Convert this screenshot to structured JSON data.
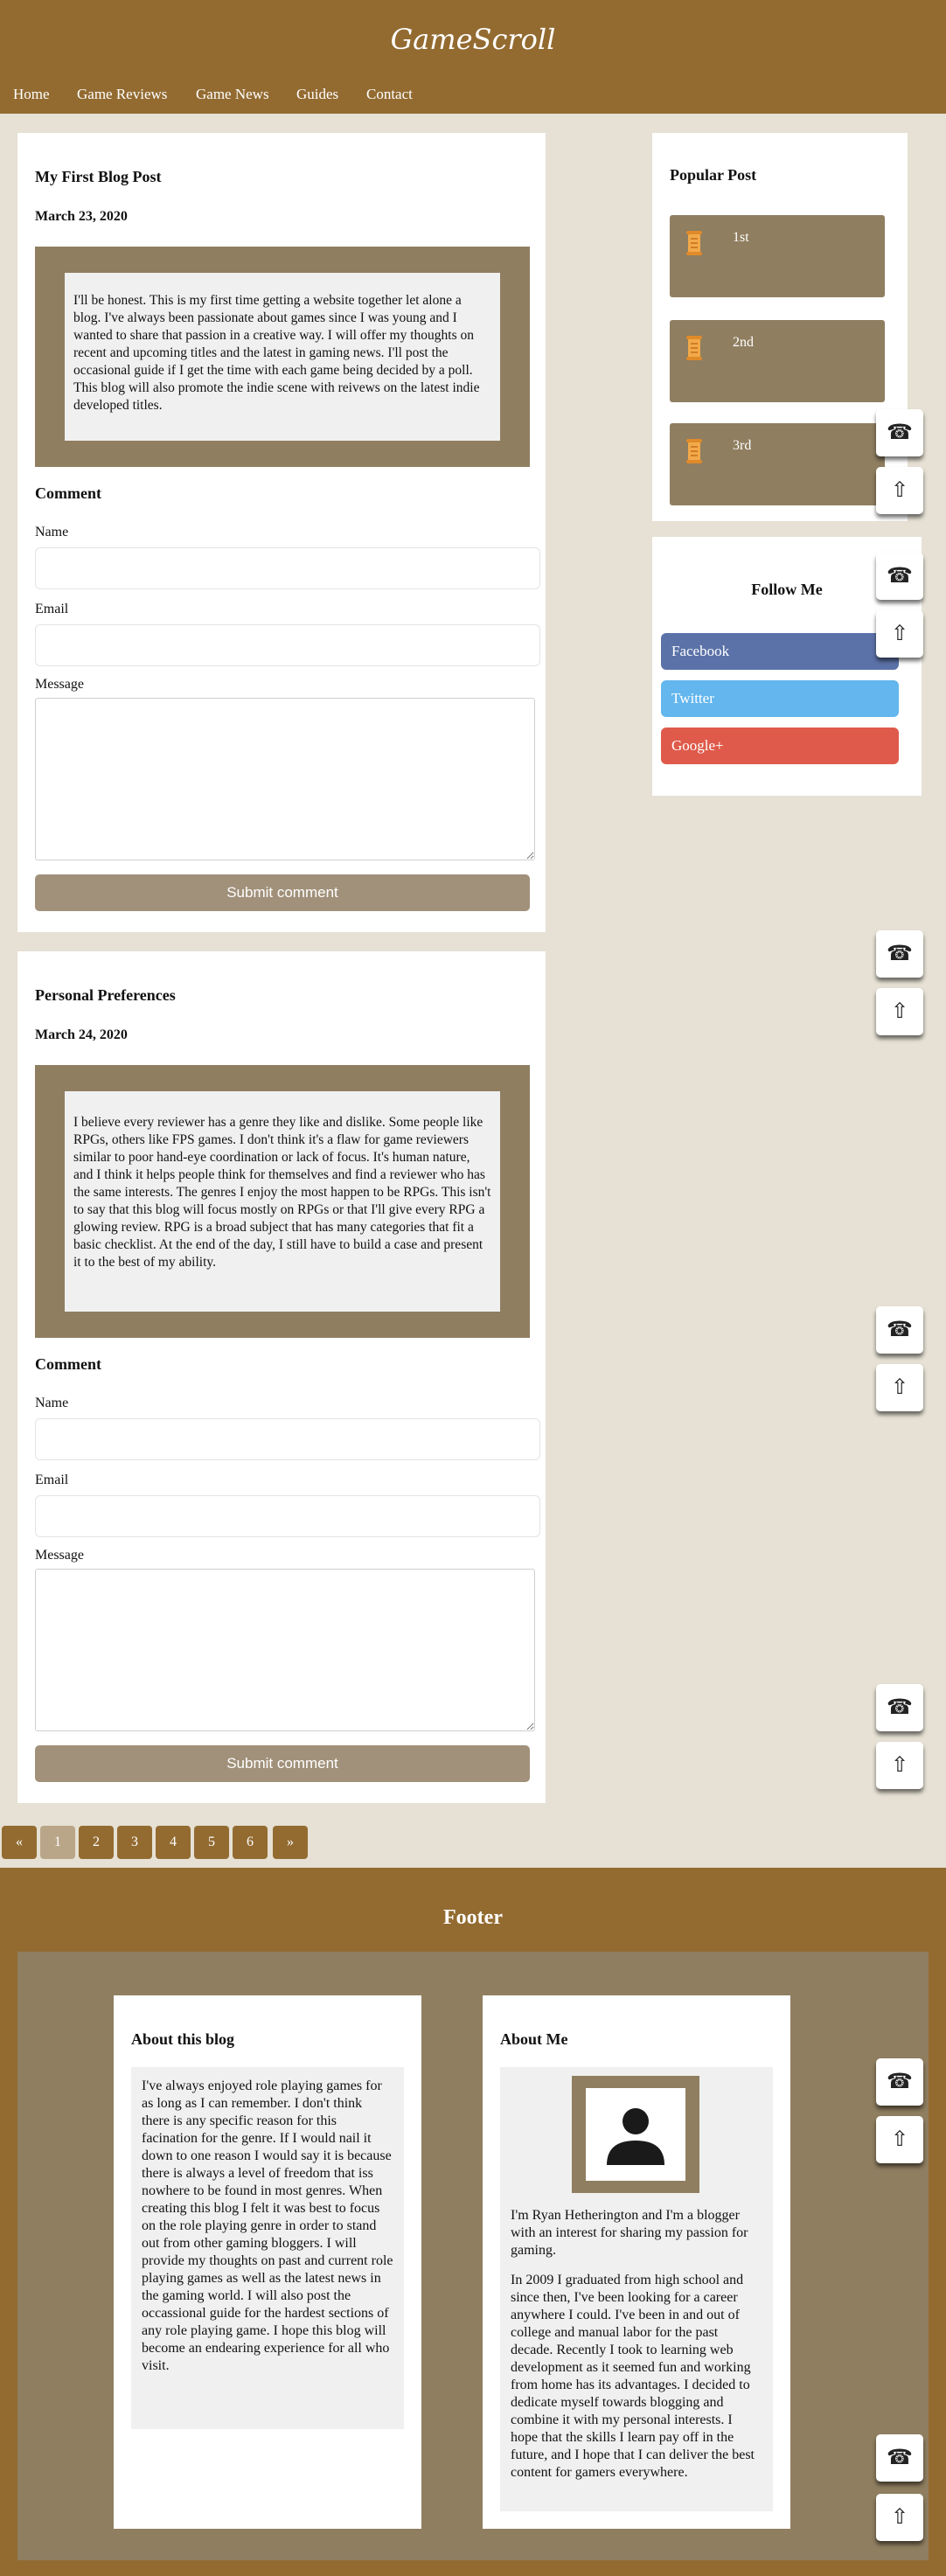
{
  "site": {
    "title": "GameScroll"
  },
  "nav": [
    "Home",
    "Game Reviews",
    "Game News",
    "Guides",
    "Contact"
  ],
  "posts": [
    {
      "title": "My First Blog Post",
      "date": "March 23, 2020",
      "body": "I'll be honest. This is my first time getting a website together let alone a blog. I've always been passionate about games since I was young and I wanted to share that passion in a creative way. I will offer my thoughts on recent and upcoming titles and the latest in gaming news. I'll post the occasional guide if I get the time with each game being decided by a poll. This blog will also promote the indie scene with reivews on the latest indie developed titles."
    },
    {
      "title": "Personal Preferences",
      "date": "March 24, 2020",
      "body": "I believe every reviewer has a genre they like and dislike. Some people like RPGs, others like FPS games. I don't think it's a flaw for game reviewers similar to poor hand-eye coordination or lack of focus. It's human nature, and I think it helps people think for themselves and find a reviewer who has the same interests. The genres I enjoy the most happen to be RPGs. This isn't to say that this blog will focus mostly on RPGs or that I'll give every RPG a glowing review. RPG is a broad subject that has many categories that fit a basic checklist. At the end of the day, I still have to build a case and present it to the best of my ability."
    }
  ],
  "comment_form": {
    "heading": "Comment",
    "name_label": "Name",
    "email_label": "Email",
    "message_label": "Message",
    "submit_label": "Submit comment"
  },
  "popular": {
    "heading": "Popular Post",
    "items": [
      "1st",
      "2nd",
      "3rd"
    ]
  },
  "follow": {
    "heading": "Follow Me",
    "buttons": [
      {
        "label": "Facebook",
        "color": "#5b72a8"
      },
      {
        "label": "Twitter",
        "color": "#63b6ee"
      },
      {
        "label": "Google+",
        "color": "#df5a4a"
      }
    ]
  },
  "floating": {
    "phone_icon": "phone-icon",
    "up_icon": "arrow-up-icon",
    "phone_glyph": "☎",
    "up_glyph": "⇧"
  },
  "pagination": {
    "prev": "«",
    "pages": [
      "1",
      "2",
      "3",
      "4",
      "5",
      "6"
    ],
    "next": "»",
    "active": "1"
  },
  "footer": {
    "title": "Footer",
    "about_blog": {
      "heading": "About this blog",
      "body": "I've always enjoyed role playing games for as long as I can remember. I don't think there is any specific reason for this facination for the genre. If I would nail it down to one reason I would say it is because there is always a level of freedom that iss nowhere to be found in most genres. When creating this blog I felt it was best to focus on the role playing genre in order to stand out from other gaming bloggers. I will provide my thoughts on past and current role playing games as well as the latest news in the gaming world. I will also post the occassional guide for the hardest sections of any role playing game. I hope this blog will become an endearing experience for all who visit."
    },
    "about_me": {
      "heading": "About Me",
      "para1": "I'm Ryan Hetherington and I'm a blogger with an interest for sharing my passion for gaming.",
      "para2": "In 2009 I graduated from high school and since then, I've been looking for a career anywhere I could. I've been in and out of college and manual labor for the past decade. Recently I took to learning web development as it seemed fun and working from home has its advantages. I decided to dedicate myself towards blogging and combine it with my personal interests. I hope that the skills I learn pay off in the future, and I hope that I can deliver the best content for gamers everywhere."
    }
  }
}
